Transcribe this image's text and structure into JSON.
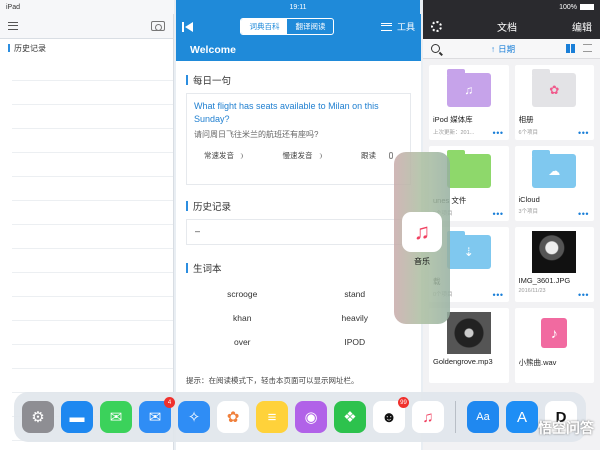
{
  "status": {
    "carrier": "iPad",
    "time": "19:11",
    "battery": "100%"
  },
  "left": {
    "history_title": "历史记录"
  },
  "middle": {
    "tabs": [
      {
        "label": "词典百科",
        "active": true
      },
      {
        "label": "翻译阅读",
        "active": false
      }
    ],
    "tools_label": "工具",
    "welcome": "Welcome",
    "daily": {
      "title": "每日一句",
      "en": "What flight has seats available to Milan on this Sunday?",
      "cn": "请问周日飞往米兰的航班还有座吗?",
      "normal_play": "常速发音",
      "slow_play": "慢速发音",
      "follow_read": "跟读"
    },
    "history": {
      "title": "历史记录",
      "value": "–"
    },
    "vocab": {
      "title": "生词本",
      "words": [
        "scrooge",
        "stand",
        "khan",
        "heavily",
        "over",
        "IPOD"
      ]
    },
    "hint": "提示：在阅读模式下，轻击本页面可以显示网址栏。"
  },
  "right": {
    "title": "文档",
    "edit": "编辑",
    "sort_label": "日期",
    "files": [
      {
        "name": "iPod 媒体库",
        "sub": "上次更新：201...",
        "color": "#c6a3ea",
        "glyph": "♫"
      },
      {
        "name": "相册",
        "sub": "6个项目",
        "color": "#e8e8ea",
        "glyph": "✿"
      },
      {
        "name": "unes 文件",
        "sub": "0个项目",
        "color": "#8ed86b",
        "glyph": ""
      },
      {
        "name": "iCloud",
        "sub": "3个项目",
        "color": "#7fc8ef",
        "glyph": "☁"
      },
      {
        "name": "载",
        "sub": "0个项目",
        "color": "#7fc8ef",
        "glyph": "⇣"
      },
      {
        "name": "IMG_3601.JPG",
        "sub": "2016/11/23",
        "color": "#222222",
        "glyph": ""
      },
      {
        "name": "Goldengrove.mp3",
        "sub": "",
        "color": "#333333",
        "glyph": ""
      },
      {
        "name": "小熊曲.wav",
        "sub": "",
        "color": "#ffffff",
        "glyph": "♪"
      }
    ]
  },
  "slideover": {
    "app_label": "音乐"
  },
  "dock": {
    "apps": [
      {
        "name": "settings",
        "color": "#8e8e93",
        "glyph": "⚙",
        "badge": ""
      },
      {
        "name": "files",
        "color": "#1e88f0",
        "glyph": "▬",
        "badge": ""
      },
      {
        "name": "messages",
        "color": "#3bd25b",
        "glyph": "✉",
        "badge": ""
      },
      {
        "name": "mail",
        "color": "#2f8df5",
        "glyph": "✉",
        "badge": "4"
      },
      {
        "name": "safari",
        "color": "#2f8df5",
        "glyph": "✧",
        "badge": ""
      },
      {
        "name": "photos",
        "color": "#ffffff",
        "glyph": "✿",
        "badge": ""
      },
      {
        "name": "notes",
        "color": "#ffd23a",
        "glyph": "≡",
        "badge": ""
      },
      {
        "name": "podcasts",
        "color": "#b162e8",
        "glyph": "◉",
        "badge": ""
      },
      {
        "name": "wechat",
        "color": "#2dc24d",
        "glyph": "❖",
        "badge": ""
      },
      {
        "name": "qq",
        "color": "#ffffff",
        "glyph": "☻",
        "badge": "99"
      },
      {
        "name": "music",
        "color": "#ffffff",
        "glyph": "♫",
        "badge": ""
      },
      {
        "name": "appstore-lite",
        "color": "#1f88f0",
        "glyph": "Aa",
        "badge": ""
      },
      {
        "name": "appstore",
        "color": "#1e8ef5",
        "glyph": "A",
        "badge": ""
      },
      {
        "name": "document-app",
        "color": "#ffffff",
        "glyph": "D",
        "badge": ""
      }
    ]
  },
  "watermark": "悟空问答"
}
